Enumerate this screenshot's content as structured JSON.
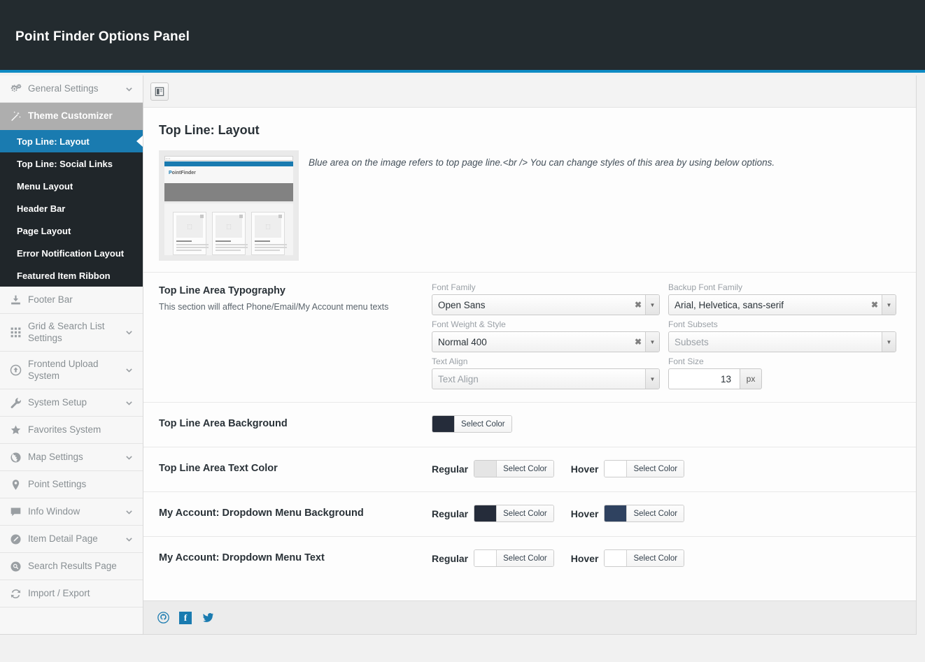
{
  "header": {
    "title": "Point Finder Options Panel"
  },
  "sidebar": {
    "top_groups": [
      {
        "label": "General Settings",
        "icon": "gears-icon",
        "caret": true
      }
    ],
    "active_parent": {
      "label": "Theme Customizer",
      "icon": "magic-wand-icon"
    },
    "subitems": [
      {
        "label": "Top Line: Layout",
        "selected": true
      },
      {
        "label": "Top Line: Social Links",
        "selected": false
      },
      {
        "label": "Menu Layout",
        "selected": false
      },
      {
        "label": "Header Bar",
        "selected": false
      },
      {
        "label": "Page Layout",
        "selected": false
      },
      {
        "label": "Error Notification Layout",
        "selected": false
      },
      {
        "label": "Featured Item Ribbon",
        "selected": false
      }
    ],
    "bottom_groups": [
      {
        "label": "Footer Bar",
        "icon": "download-icon",
        "caret": false,
        "tall": false
      },
      {
        "label": "Grid & Search List Settings",
        "icon": "grid-icon",
        "caret": true,
        "tall": true
      },
      {
        "label": "Frontend Upload System",
        "icon": "upload-circle-icon",
        "caret": true,
        "tall": true
      },
      {
        "label": "System Setup",
        "icon": "wrench-icon",
        "caret": true,
        "tall": false
      },
      {
        "label": "Favorites System",
        "icon": "star-icon",
        "caret": false,
        "tall": false
      },
      {
        "label": "Map Settings",
        "icon": "globe-icon",
        "caret": true,
        "tall": false
      },
      {
        "label": "Point Settings",
        "icon": "map-pin-icon",
        "caret": false,
        "tall": false
      },
      {
        "label": "Info Window",
        "icon": "speech-bubble-icon",
        "caret": true,
        "tall": false
      },
      {
        "label": "Item Detail Page",
        "icon": "pencil-circle-icon",
        "caret": true,
        "tall": false
      },
      {
        "label": "Search Results Page",
        "icon": "search-circle-icon",
        "caret": false,
        "tall": false
      },
      {
        "label": "Import / Export",
        "icon": "sync-icon",
        "caret": false,
        "tall": false
      }
    ]
  },
  "toolbar": {
    "expand_icon": "panel-layout-icon"
  },
  "page": {
    "section_title": "Top Line: Layout",
    "info_text": "Blue area on the image refers to top page line.<br /> You can change styles of this area by using below options.",
    "preview_logo_first": "P",
    "preview_logo_rest": "ointFinder"
  },
  "typography": {
    "title": "Top Line Area Typography",
    "subtitle": "This section will affect Phone/Email/My Account menu texts",
    "fields": [
      {
        "label": "Font Family",
        "value": "Open Sans",
        "placeholder": false,
        "clearable": true
      },
      {
        "label": "Backup Font Family",
        "value": "Arial, Helvetica, sans-serif",
        "placeholder": false,
        "clearable": true
      },
      {
        "label": "Font Weight & Style",
        "value": "Normal 400",
        "placeholder": false,
        "clearable": true
      },
      {
        "label": "Font Subsets",
        "value": "Subsets",
        "placeholder": true,
        "clearable": false
      },
      {
        "label": "Text Align",
        "value": "Text Align",
        "placeholder": true,
        "clearable": false
      }
    ],
    "font_size": {
      "label": "Font Size",
      "value": "13",
      "unit": "px"
    }
  },
  "color_rows": [
    {
      "title": "Top Line Area Background",
      "states": [
        {
          "state_label": "",
          "swatch": "#252c3a",
          "button_label": "Select Color"
        }
      ]
    },
    {
      "title": "Top Line Area Text Color",
      "states": [
        {
          "state_label": "Regular",
          "swatch": "#e5e5e5",
          "button_label": "Select Color"
        },
        {
          "state_label": "Hover",
          "swatch": "#ffffff",
          "button_label": "Select Color"
        }
      ]
    },
    {
      "title": "My Account: Dropdown Menu Background",
      "states": [
        {
          "state_label": "Regular",
          "swatch": "#252c3a",
          "button_label": "Select Color"
        },
        {
          "state_label": "Hover",
          "swatch": "#2f4260",
          "button_label": "Select Color"
        }
      ]
    },
    {
      "title": "My Account: Dropdown Menu Text",
      "states": [
        {
          "state_label": "Regular",
          "swatch": "#ffffff",
          "button_label": "Select Color"
        },
        {
          "state_label": "Hover",
          "swatch": "#ffffff",
          "button_label": "Select Color"
        }
      ]
    }
  ],
  "footer": {
    "socials": [
      {
        "name": "github-icon"
      },
      {
        "name": "facebook-icon",
        "glyph": "f"
      },
      {
        "name": "twitter-icon"
      }
    ]
  },
  "colors": {
    "accent": "#0f8bc4",
    "active_nav": "#1a7bb0",
    "header_bg": "#232b2f",
    "subnav_bg": "#20262a"
  }
}
